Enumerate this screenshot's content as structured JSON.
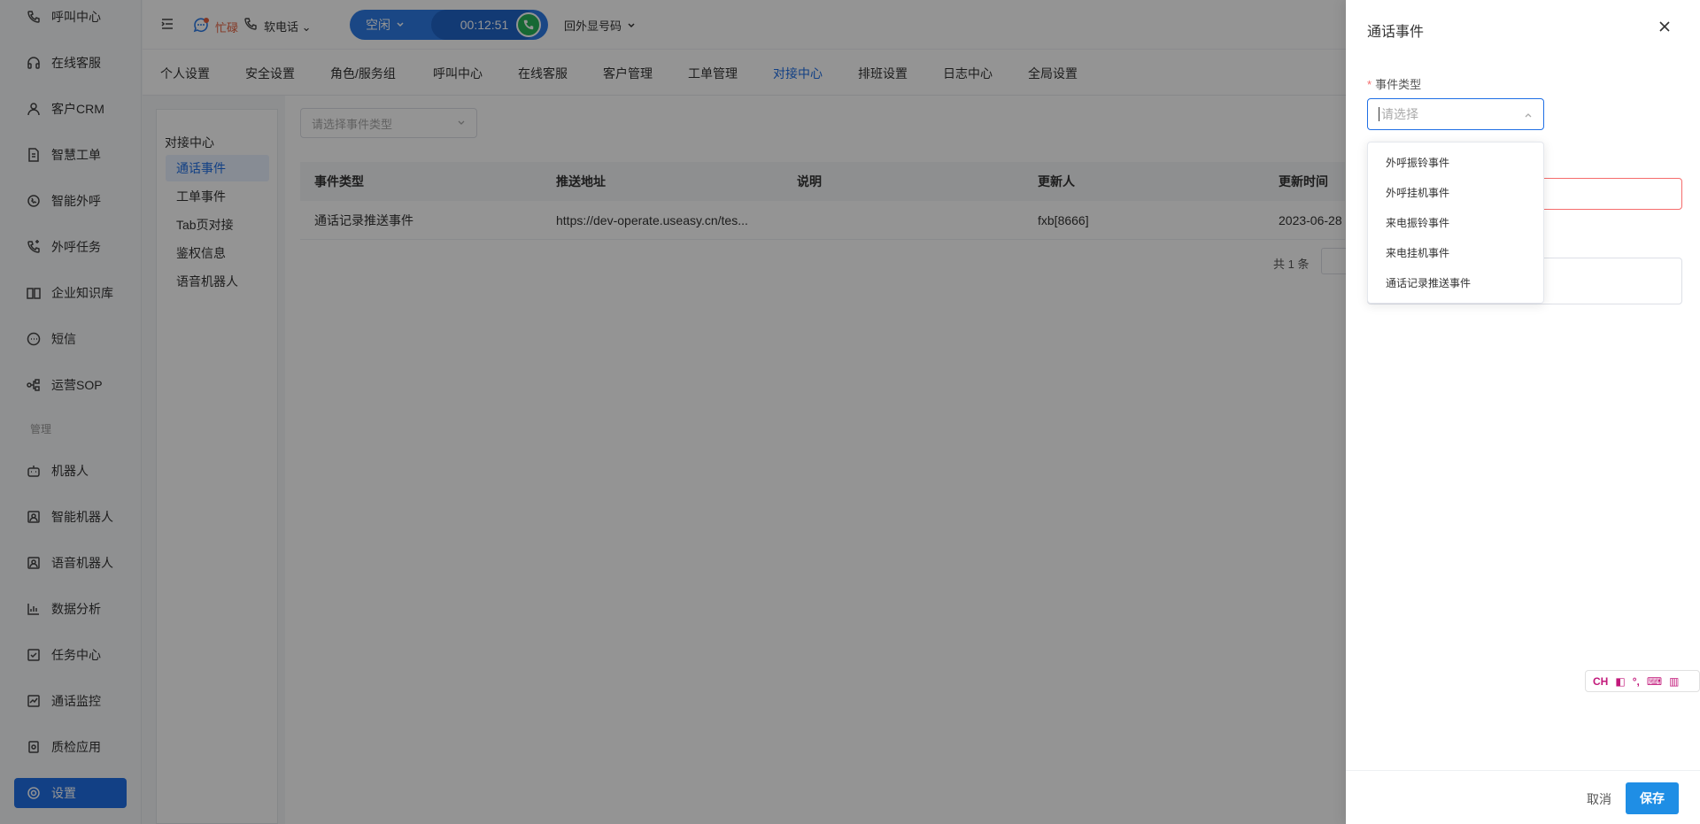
{
  "sidebar": {
    "items": [
      {
        "label": "呼叫中心",
        "icon": "phone-icon"
      },
      {
        "label": "在线客服",
        "icon": "headset-icon"
      },
      {
        "label": "客户CRM",
        "icon": "user-icon"
      },
      {
        "label": "智慧工单",
        "icon": "document-icon"
      },
      {
        "label": "智能外呼",
        "icon": "outbound-call-icon"
      },
      {
        "label": "外呼任务",
        "icon": "call-task-icon"
      },
      {
        "label": "企业知识库",
        "icon": "book-icon"
      },
      {
        "label": "短信",
        "icon": "sms-icon"
      },
      {
        "label": "运营SOP",
        "icon": "flow-icon"
      }
    ],
    "section_label": "管理",
    "admin_items": [
      {
        "label": "机器人",
        "icon": "robot-icon"
      },
      {
        "label": "智能机器人",
        "icon": "smart-robot-icon"
      },
      {
        "label": "语音机器人",
        "icon": "voice-robot-icon"
      },
      {
        "label": "数据分析",
        "icon": "chart-icon"
      },
      {
        "label": "任务中心",
        "icon": "task-icon"
      },
      {
        "label": "通话监控",
        "icon": "monitor-icon"
      },
      {
        "label": "质检应用",
        "icon": "quality-icon"
      },
      {
        "label": "设置",
        "icon": "gear-icon"
      }
    ]
  },
  "topbar": {
    "status_text": "忙碌",
    "soft_phone": "软电话",
    "call_state": "空闲",
    "call_timer": "00:12:51",
    "caller_id": "回外显号码"
  },
  "tabs": [
    "个人设置",
    "安全设置",
    "角色/服务组",
    "呼叫中心",
    "在线客服",
    "客户管理",
    "工单管理",
    "对接中心",
    "排班设置",
    "日志中心",
    "全局设置"
  ],
  "subnav": {
    "title": "对接中心",
    "items": [
      "通话事件",
      "工单事件",
      "Tab页对接",
      "鉴权信息",
      "语音机器人"
    ]
  },
  "main": {
    "filter_placeholder": "请选择事件类型",
    "table": {
      "headers": [
        "事件类型",
        "推送地址",
        "说明",
        "更新人",
        "更新时间"
      ],
      "rows": [
        [
          "通话记录推送事件",
          "https://dev-operate.useasy.cn/tes...",
          "",
          "fxb[8666]",
          "2023-06-28"
        ]
      ]
    },
    "total": "共 1 条"
  },
  "drawer": {
    "title": "通话事件",
    "field_label": "事件类型",
    "select_placeholder": "请选择",
    "options": [
      "外呼振铃事件",
      "外呼挂机事件",
      "来电振铃事件",
      "来电挂机事件",
      "通话记录推送事件"
    ],
    "cancel_label": "取消",
    "save_label": "保存"
  },
  "ime": {
    "lang": "CH"
  },
  "colors": {
    "accent": "#1f6fe5",
    "call_pill": "#2d7be5",
    "call_green": "#29b35a",
    "error": "#f56c6c",
    "busy": "#e45d3b"
  }
}
